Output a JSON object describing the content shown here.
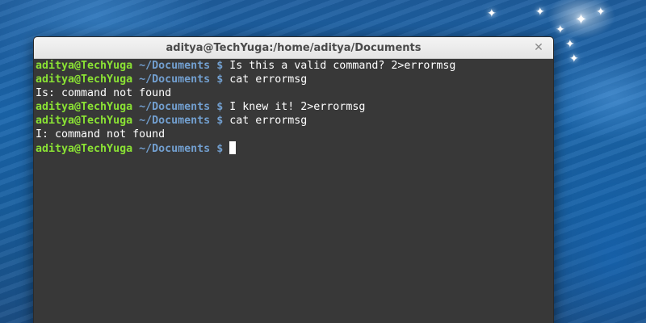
{
  "window": {
    "title": "aditya@TechYuga:/home/aditya/Documents",
    "close_icon": "close-icon"
  },
  "terminal": {
    "prompt_user": "aditya@TechYuga",
    "prompt_path": "~/Documents",
    "prompt_symbol": "$",
    "lines": [
      {
        "type": "command",
        "text": "Is this a valid command? 2>errormsg"
      },
      {
        "type": "command",
        "text": "cat errormsg"
      },
      {
        "type": "output",
        "text": "Is: command not found"
      },
      {
        "type": "command",
        "text": "I knew it! 2>errormsg"
      },
      {
        "type": "command",
        "text": "cat errormsg"
      },
      {
        "type": "output",
        "text": "I: command not found"
      },
      {
        "type": "prompt",
        "text": ""
      }
    ]
  },
  "colors": {
    "prompt_user": "#8ae234",
    "prompt_path": "#729fcf",
    "terminal_bg": "#383838"
  }
}
